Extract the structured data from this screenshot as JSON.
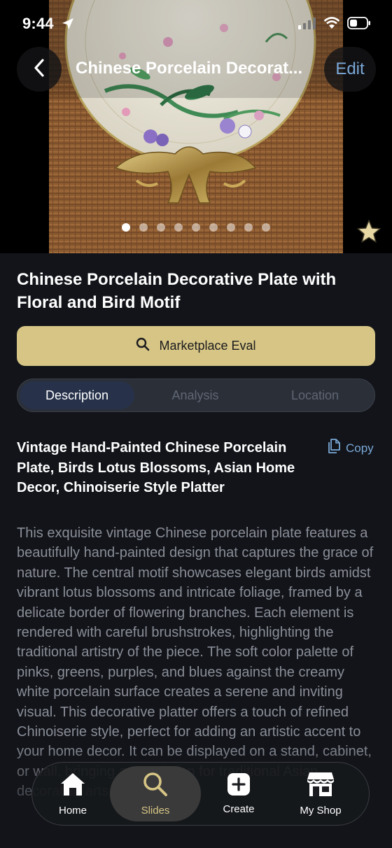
{
  "status_bar": {
    "time": "9:44"
  },
  "nav": {
    "title": "Chinese Porcelain Decorat...",
    "edit_label": "Edit"
  },
  "gallery": {
    "image_count": 9,
    "active_index": 0,
    "favorited": true
  },
  "item": {
    "title": "Chinese Porcelain Decorative Plate with Floral and Bird Motif"
  },
  "eval_button": {
    "label": "Marketplace Eval"
  },
  "segments": [
    {
      "label": "Description",
      "active": true
    },
    {
      "label": "Analysis",
      "active": false
    },
    {
      "label": "Location",
      "active": false
    }
  ],
  "description": {
    "heading": "Vintage Hand-Painted Chinese Porcelain Plate, Birds Lotus Blossoms, Asian Home Decor, Chinoiserie Style Platter",
    "copy_label": "Copy",
    "body": "This exquisite vintage Chinese porcelain plate features a beautifully hand-painted design that captures the grace of nature. The central motif showcases elegant birds amidst vibrant lotus blossoms and intricate foliage, framed by a delicate border of flowering branches. Each element is rendered with careful brushstrokes, highlighting the traditional artistry of the piece. The soft color palette of pinks, greens, purples, and blues against the creamy white porcelain surface creates a serene and inviting visual. This decorative platter offers a touch of refined Chinoiserie style, perfect for adding an artistic accent to your home decor. It can be displayed on a stand, cabinet, or wall, bringing appreciation for traditional Asian decorative arts."
  },
  "tabs": [
    {
      "label": "Home",
      "icon": "house-icon",
      "active": false
    },
    {
      "label": "Slides",
      "icon": "search-icon",
      "active": true
    },
    {
      "label": "Create",
      "icon": "plus-square-icon",
      "active": false
    },
    {
      "label": "My Shop",
      "icon": "storefront-icon",
      "active": false
    }
  ],
  "colors": {
    "background": "#121419",
    "accent_gold": "#d6c585",
    "link_blue": "#7aa8d8",
    "segment_active": "#27324a",
    "body_text": "#8a8e98"
  }
}
